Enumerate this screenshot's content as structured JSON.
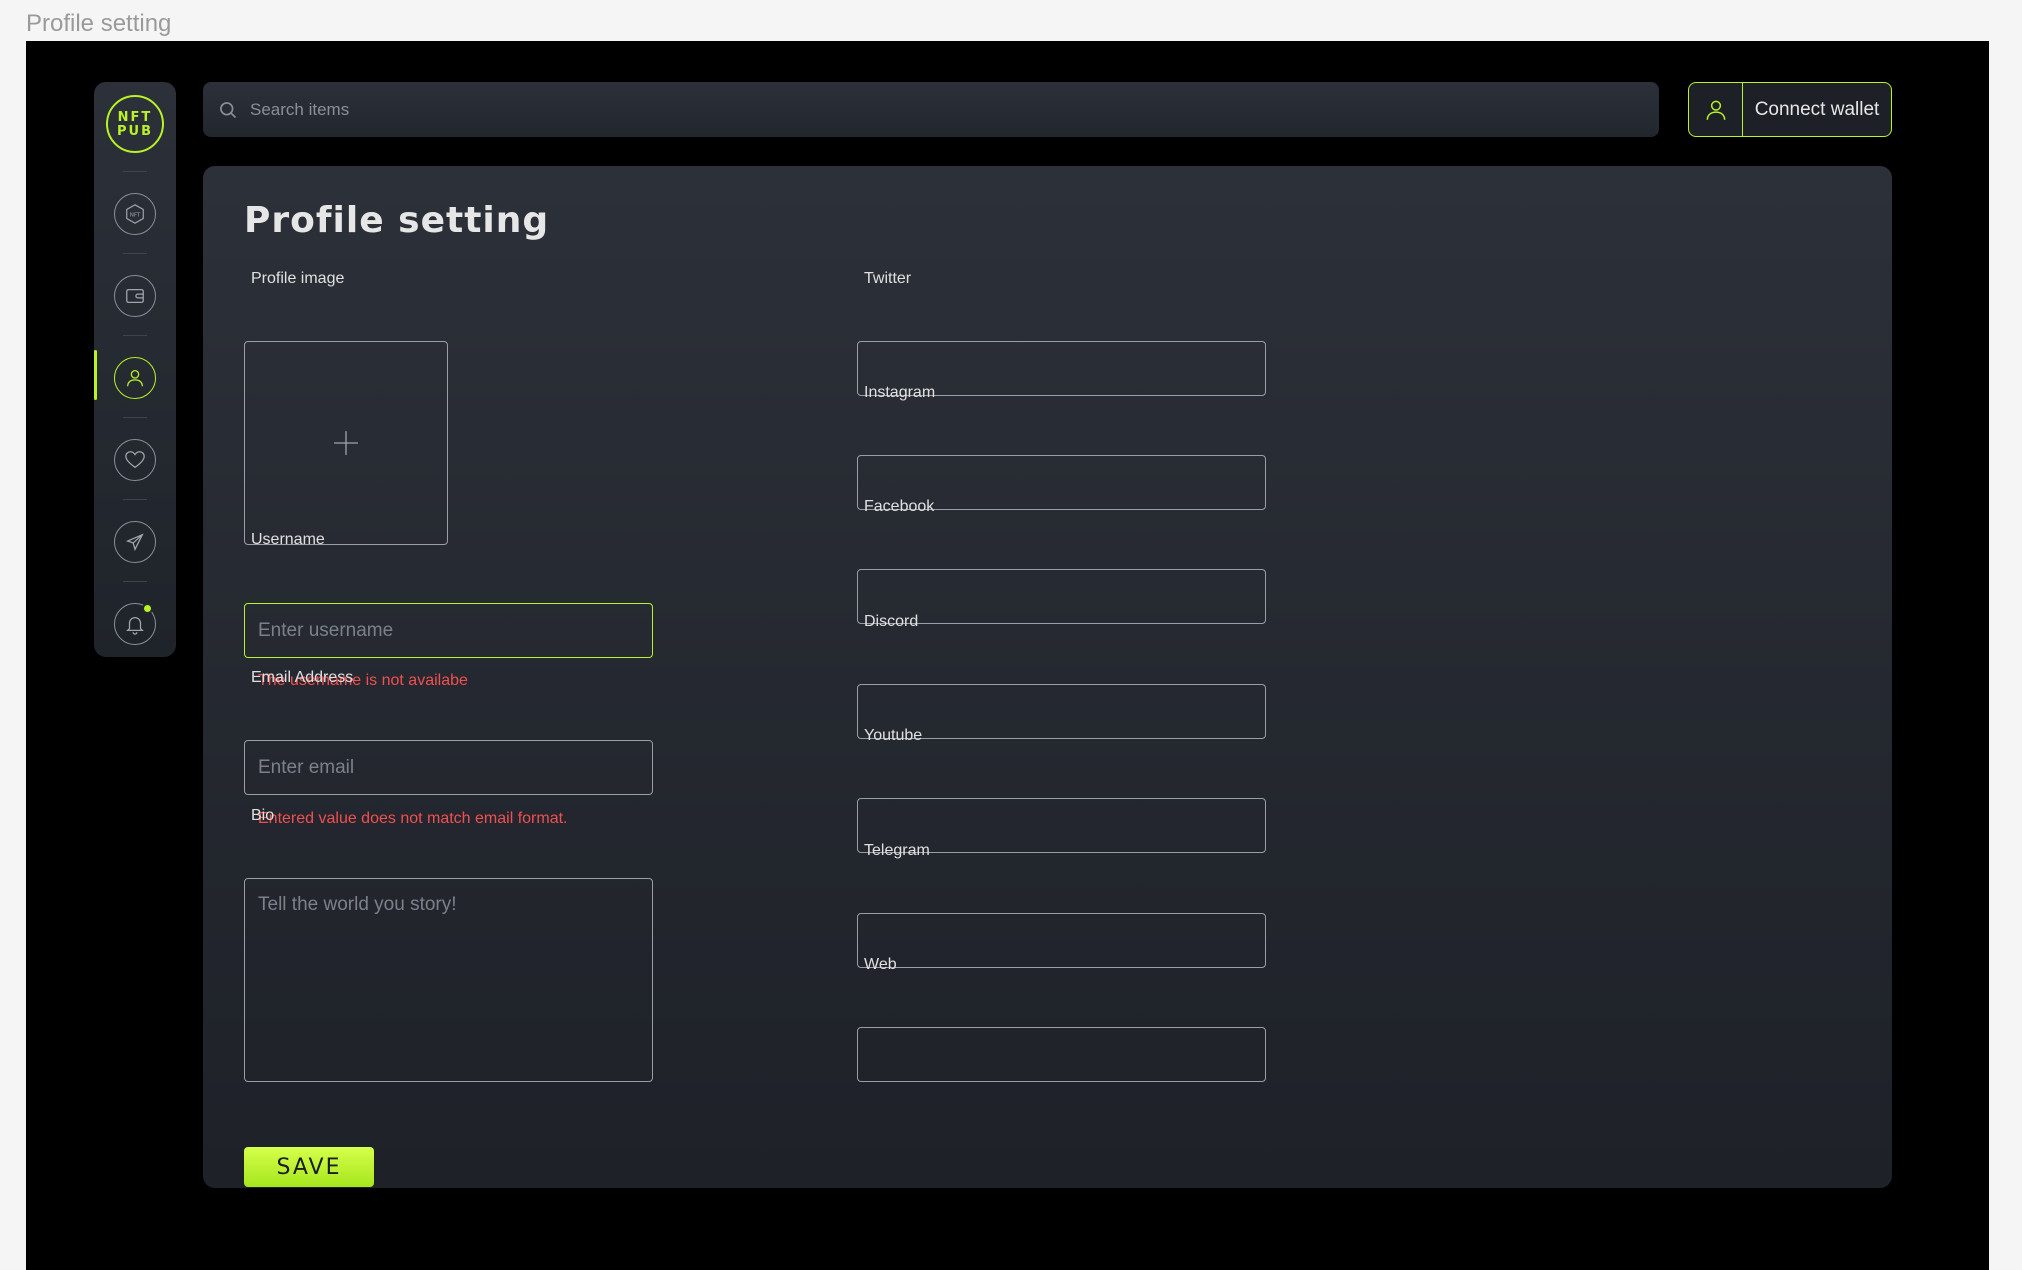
{
  "frame_label": "Profile setting",
  "logo": {
    "line1": "NFT",
    "line2": "PUB"
  },
  "nav": [
    {
      "name": "nft",
      "icon": "nft-hexagon-icon"
    },
    {
      "name": "wallet",
      "icon": "wallet-icon"
    },
    {
      "name": "profile",
      "icon": "user-icon",
      "active": true
    },
    {
      "name": "favorites",
      "icon": "heart-icon"
    },
    {
      "name": "launch",
      "icon": "rocket-icon"
    },
    {
      "name": "notifications",
      "icon": "bell-icon",
      "has_badge": true
    }
  ],
  "search": {
    "placeholder": "Search items",
    "icon": "search-icon"
  },
  "wallet": {
    "label": "Connect wallet",
    "icon": "user-icon"
  },
  "page_title": "Profile setting",
  "form": {
    "profile_image_label": "Profile image",
    "username": {
      "label": "Username",
      "placeholder": "Enter username",
      "value": "",
      "error": "The username is not availabe"
    },
    "email": {
      "label": "Email Address",
      "placeholder": "Enter email",
      "value": "",
      "error": "Entered value does not match email format."
    },
    "bio": {
      "label": "Bio",
      "placeholder": "Tell the world you story!"
    },
    "social": {
      "twitter": {
        "label": "Twitter",
        "value": ""
      },
      "instagram": {
        "label": "Instagram",
        "value": ""
      },
      "facebook": {
        "label": "Facebook",
        "value": ""
      },
      "discord": {
        "label": "Discord",
        "value": ""
      },
      "youtube": {
        "label": "Youtube",
        "value": ""
      },
      "telegram": {
        "label": "Telegram",
        "value": ""
      },
      "web": {
        "label": "Web",
        "value": ""
      }
    },
    "save_label": "SAVE"
  },
  "colors": {
    "accent": "#b8f227",
    "error": "#f0504f",
    "panel": "#2c3038",
    "background": "#000000"
  }
}
